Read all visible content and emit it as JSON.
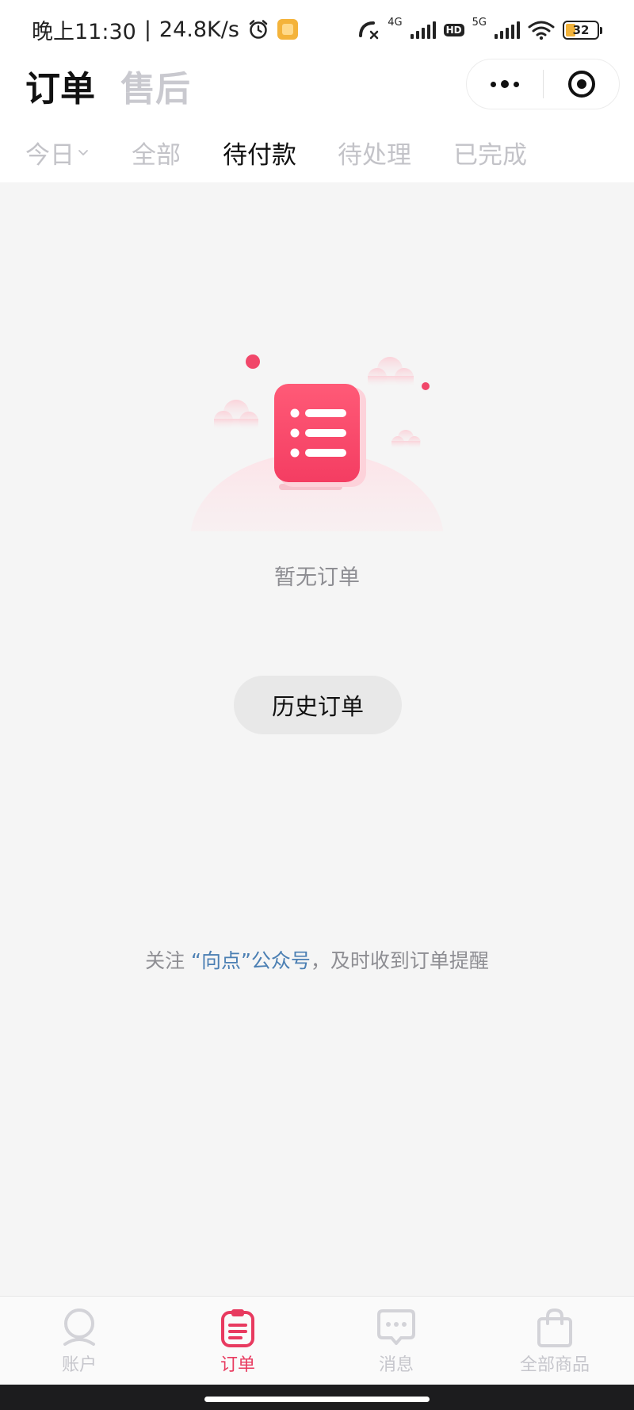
{
  "status_bar": {
    "time": "晚上11:30",
    "separator": "|",
    "net_speed": "24.8K/s",
    "signal1_label": "4G",
    "hd_label": "HD",
    "signal2_label": "5G",
    "battery": "32",
    "battery_color": "#f2b33b"
  },
  "header": {
    "title_orders": "订单",
    "title_aftersale": "售后"
  },
  "tabs": [
    {
      "label": "今日",
      "active": false
    },
    {
      "label": "全部",
      "active": false
    },
    {
      "label": "待付款",
      "active": true
    },
    {
      "label": "待处理",
      "active": false
    },
    {
      "label": "已完成",
      "active": false
    }
  ],
  "empty_state": {
    "message": "暂无订单",
    "history_button": "历史订单"
  },
  "follow": {
    "prefix": "关注 ",
    "link": "“向点”公众号",
    "suffix": "，及时收到订单提醒",
    "link_color": "#4b7fb3"
  },
  "bottom_nav": [
    {
      "label": "账户",
      "icon": "account-icon",
      "active": false
    },
    {
      "label": "订单",
      "icon": "orders-icon",
      "active": true
    },
    {
      "label": "消息",
      "icon": "message-icon",
      "active": false
    },
    {
      "label": "全部商品",
      "icon": "shopping-bag-icon",
      "active": false
    }
  ],
  "colors": {
    "accent": "#e83a5f",
    "illustration": "#fb4f6f",
    "page_bg": "#f5f5f5"
  }
}
